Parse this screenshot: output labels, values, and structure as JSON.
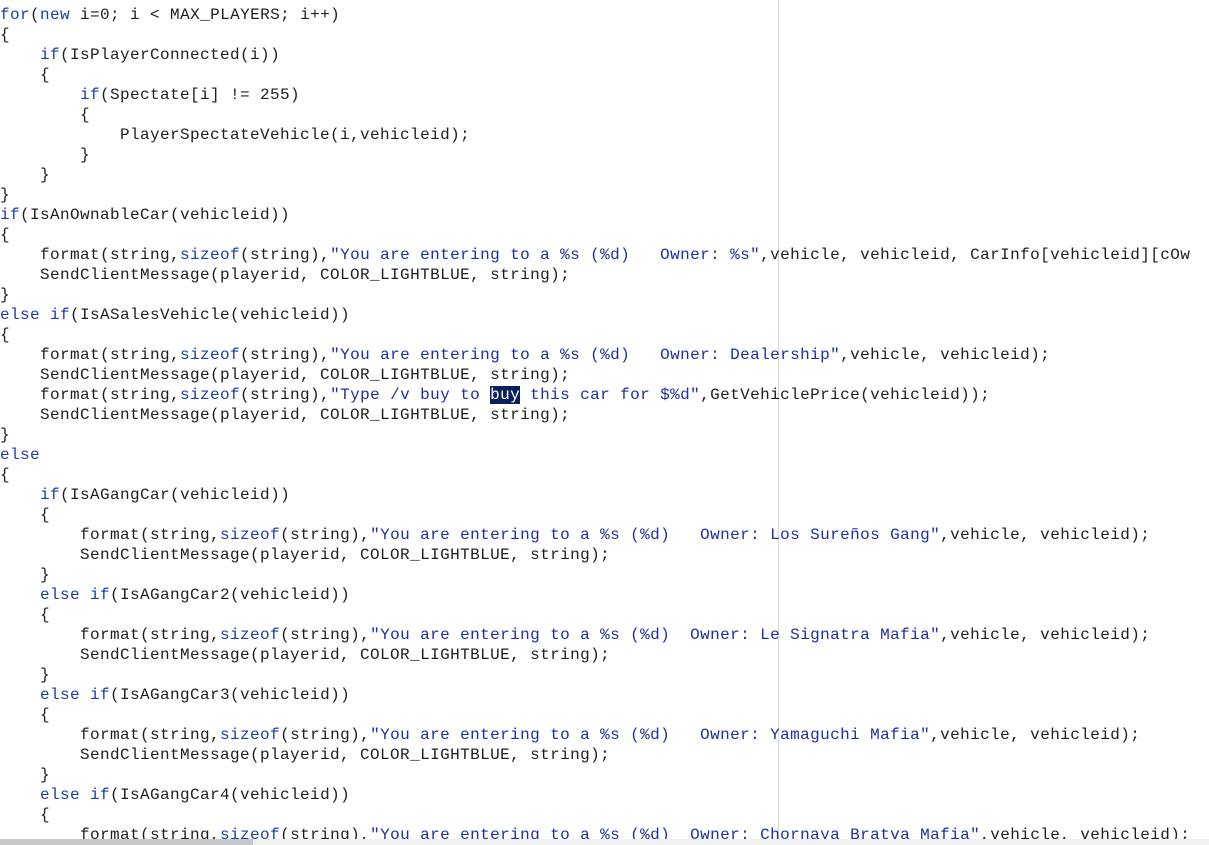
{
  "editor": {
    "lines": [
      [
        {
          "t": "for",
          "c": "kw"
        },
        {
          "t": "(",
          "c": "code"
        },
        {
          "t": "new",
          "c": "kw"
        },
        {
          "t": " i=0; i < MAX_PLAYERS; i++)",
          "c": "code"
        }
      ],
      [
        {
          "t": "{",
          "c": "code"
        }
      ],
      [
        {
          "t": "    ",
          "c": "code"
        },
        {
          "t": "if",
          "c": "kw"
        },
        {
          "t": "(IsPlayerConnected(i))",
          "c": "code"
        }
      ],
      [
        {
          "t": "    {",
          "c": "code"
        }
      ],
      [
        {
          "t": "        ",
          "c": "code"
        },
        {
          "t": "if",
          "c": "kw"
        },
        {
          "t": "(Spectate[i] != 255)",
          "c": "code"
        }
      ],
      [
        {
          "t": "        {",
          "c": "code"
        }
      ],
      [
        {
          "t": "            PlayerSpectateVehicle(i,vehicleid);",
          "c": "code"
        }
      ],
      [
        {
          "t": "        }",
          "c": "code"
        }
      ],
      [
        {
          "t": "    }",
          "c": "code"
        }
      ],
      [
        {
          "t": "}",
          "c": "code"
        }
      ],
      [
        {
          "t": "if",
          "c": "kw"
        },
        {
          "t": "(IsAnOwnableCar(vehicleid))",
          "c": "code"
        }
      ],
      [
        {
          "t": "{",
          "c": "code"
        }
      ],
      [
        {
          "t": "    format(string,",
          "c": "code"
        },
        {
          "t": "sizeof",
          "c": "kw"
        },
        {
          "t": "(string),",
          "c": "code"
        },
        {
          "t": "\"You are entering to a %s (%d)   Owner: %s\"",
          "c": "str"
        },
        {
          "t": ",vehicle, vehicleid, CarInfo[vehicleid][cOw",
          "c": "code"
        }
      ],
      [
        {
          "t": "    SendClientMessage(playerid, COLOR_LIGHTBLUE, string);",
          "c": "code"
        }
      ],
      [
        {
          "t": "}",
          "c": "code"
        }
      ],
      [
        {
          "t": "else if",
          "c": "kw"
        },
        {
          "t": "(IsASalesVehicle(vehicleid))",
          "c": "code"
        }
      ],
      [
        {
          "t": "{",
          "c": "code"
        }
      ],
      [
        {
          "t": "    format(string,",
          "c": "code"
        },
        {
          "t": "sizeof",
          "c": "kw"
        },
        {
          "t": "(string),",
          "c": "code"
        },
        {
          "t": "\"You are entering to a %s (%d)   Owner: Dealership\"",
          "c": "str"
        },
        {
          "t": ",vehicle, vehicleid);",
          "c": "code"
        }
      ],
      [
        {
          "t": "    SendClientMessage(playerid, COLOR_LIGHTBLUE, string);",
          "c": "code"
        }
      ],
      [
        {
          "t": "    format(string,",
          "c": "code"
        },
        {
          "t": "sizeof",
          "c": "kw"
        },
        {
          "t": "(string),",
          "c": "code"
        },
        {
          "t": "\"Type /v buy to ",
          "c": "str"
        },
        {
          "t": "buy",
          "c": "sel"
        },
        {
          "t": " this car for $%d\"",
          "c": "str"
        },
        {
          "t": ",GetVehiclePrice(vehicleid));",
          "c": "code"
        }
      ],
      [
        {
          "t": "    SendClientMessage(playerid, COLOR_LIGHTBLUE, string);",
          "c": "code"
        }
      ],
      [
        {
          "t": "}",
          "c": "code"
        }
      ],
      [
        {
          "t": "else",
          "c": "kw"
        }
      ],
      [
        {
          "t": "{",
          "c": "code"
        }
      ],
      [
        {
          "t": "    ",
          "c": "code"
        },
        {
          "t": "if",
          "c": "kw"
        },
        {
          "t": "(IsAGangCar(vehicleid))",
          "c": "code"
        }
      ],
      [
        {
          "t": "    {",
          "c": "code"
        }
      ],
      [
        {
          "t": "        format(string,",
          "c": "code"
        },
        {
          "t": "sizeof",
          "c": "kw"
        },
        {
          "t": "(string),",
          "c": "code"
        },
        {
          "t": "\"You are entering to a %s (%d)   Owner: Los Sureños Gang\"",
          "c": "str"
        },
        {
          "t": ",vehicle, vehicleid);",
          "c": "code"
        }
      ],
      [
        {
          "t": "        SendClientMessage(playerid, COLOR_LIGHTBLUE, string);",
          "c": "code"
        }
      ],
      [
        {
          "t": "    }",
          "c": "code"
        }
      ],
      [
        {
          "t": "    ",
          "c": "code"
        },
        {
          "t": "else if",
          "c": "kw"
        },
        {
          "t": "(IsAGangCar2(vehicleid))",
          "c": "code"
        }
      ],
      [
        {
          "t": "    {",
          "c": "code"
        }
      ],
      [
        {
          "t": "        format(string,",
          "c": "code"
        },
        {
          "t": "sizeof",
          "c": "kw"
        },
        {
          "t": "(string),",
          "c": "code"
        },
        {
          "t": "\"You are entering to a %s (%d)  Owner: Le Signatra Mafia\"",
          "c": "str"
        },
        {
          "t": ",vehicle, vehicleid);",
          "c": "code"
        }
      ],
      [
        {
          "t": "        SendClientMessage(playerid, COLOR_LIGHTBLUE, string);",
          "c": "code"
        }
      ],
      [
        {
          "t": "    }",
          "c": "code"
        }
      ],
      [
        {
          "t": "    ",
          "c": "code"
        },
        {
          "t": "else if",
          "c": "kw"
        },
        {
          "t": "(IsAGangCar3(vehicleid))",
          "c": "code"
        }
      ],
      [
        {
          "t": "    {",
          "c": "code"
        }
      ],
      [
        {
          "t": "        format(string,",
          "c": "code"
        },
        {
          "t": "sizeof",
          "c": "kw"
        },
        {
          "t": "(string),",
          "c": "code"
        },
        {
          "t": "\"You are entering to a %s (%d)   Owner: Yamaguchi Mafia\"",
          "c": "str"
        },
        {
          "t": ",vehicle, vehicleid);",
          "c": "code"
        }
      ],
      [
        {
          "t": "        SendClientMessage(playerid, COLOR_LIGHTBLUE, string);",
          "c": "code"
        }
      ],
      [
        {
          "t": "    }",
          "c": "code"
        }
      ],
      [
        {
          "t": "    ",
          "c": "code"
        },
        {
          "t": "else if",
          "c": "kw"
        },
        {
          "t": "(IsAGangCar4(vehicleid))",
          "c": "code"
        }
      ],
      [
        {
          "t": "    {",
          "c": "code"
        }
      ],
      [
        {
          "t": "        format(string,",
          "c": "code"
        },
        {
          "t": "sizeof",
          "c": "kw"
        },
        {
          "t": "(string),",
          "c": "code"
        },
        {
          "t": "\"You are entering to a %s (%d)  Owner: Chornaya Bratva Mafia\"",
          "c": "str"
        },
        {
          "t": ",vehicle, vehicleid);",
          "c": "code"
        }
      ]
    ]
  },
  "colors": {
    "keyword": "#1b3ea8",
    "string": "#1f2f9f",
    "code": "#1e1e1e",
    "selection": "#0a1f5c"
  },
  "selection": {
    "text": "buy"
  }
}
